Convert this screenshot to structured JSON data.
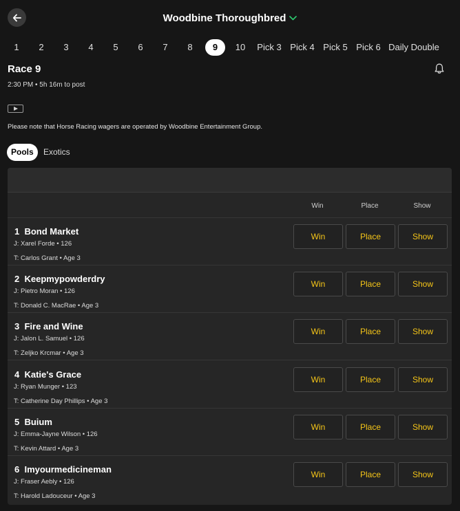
{
  "header": {
    "title": "Woodbine Thoroughbred"
  },
  "race_nav": {
    "items": [
      "1",
      "2",
      "3",
      "4",
      "5",
      "6",
      "7",
      "8",
      "9",
      "10",
      "Pick 3",
      "Pick 4",
      "Pick 5",
      "Pick 6",
      "Daily Double"
    ],
    "active": "9"
  },
  "race": {
    "title": "Race 9",
    "post_time": "2:30 PM • 5h 16m to post"
  },
  "notice": "Please note that Horse Racing wagers are operated by Woodbine Entertainment Group.",
  "tabs": [
    "Pools",
    "Exotics"
  ],
  "columns": [
    "Win",
    "Place",
    "Show"
  ],
  "bet_labels": {
    "win": "Win",
    "place": "Place",
    "show": "Show"
  },
  "runners": [
    {
      "num": "1",
      "name": "Bond Market",
      "jockey": "J: Xarel Forde • 126",
      "trainer": "T: Carlos Grant • Age 3"
    },
    {
      "num": "2",
      "name": "Keepmypowderdry",
      "jockey": "J: Pietro Moran • 126",
      "trainer": "T: Donald C. MacRae • Age 3"
    },
    {
      "num": "3",
      "name": "Fire and Wine",
      "jockey": "J: Jalon L. Samuel • 126",
      "trainer": "T: Zeljko Krcmar • Age 3"
    },
    {
      "num": "4",
      "name": "Katie's Grace",
      "jockey": "J: Ryan Munger • 123",
      "trainer": "T: Catherine Day Phillips • Age 3"
    },
    {
      "num": "5",
      "name": "Buium",
      "jockey": "J: Emma-Jayne Wilson • 126",
      "trainer": "T: Kevin Attard • Age 3"
    },
    {
      "num": "6",
      "name": "Imyourmedicineman",
      "jockey": "J: Fraser Aebly • 126",
      "trainer": "T: Harold Ladouceur • Age 3"
    }
  ],
  "colors": {
    "accent_green": "#2ecc71",
    "bet_text": "#f5c518",
    "background": "#161616"
  }
}
